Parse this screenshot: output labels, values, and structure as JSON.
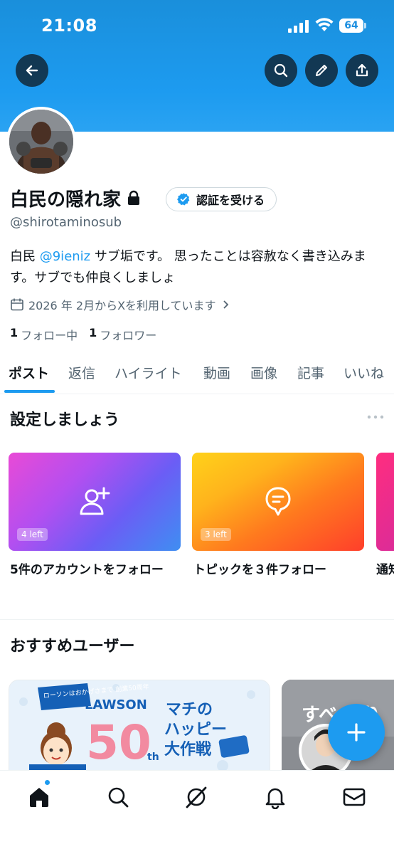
{
  "status_bar": {
    "time": "21:08",
    "battery": "64"
  },
  "profile": {
    "display_name": "白民の隠れ家",
    "verify_button": "認証を受ける",
    "handle": "@shirotaminosub",
    "bio_prefix": "白民 ",
    "bio_mention": "@9ieniz",
    "bio_suffix": " サブ垢です。 思ったことは容赦なく書き込みます。サブでも仲良くしましょ",
    "joined": "2026 年 2月からXを利用しています",
    "following_count": "1",
    "following_label": "フォロー中",
    "followers_count": "1",
    "followers_label": "フォロワー"
  },
  "tabs": [
    "ポスト",
    "返信",
    "ハイライト",
    "動画",
    "画像",
    "記事",
    "いいね"
  ],
  "setup": {
    "title": "設定しましょう",
    "cards": [
      {
        "badge": "4 left",
        "label": "5件のアカウントをフォロー",
        "icon": "add-user-icon"
      },
      {
        "badge": "3 left",
        "label": "トピックを３件フォロー",
        "icon": "topic-icon"
      },
      {
        "label": "通知"
      }
    ]
  },
  "recommended": {
    "title": "おすすめユーザー",
    "promo": {
      "ribbon_text": "ローソンはおかげさまで 創業50周年",
      "brand": "LAWSON",
      "number": "50",
      "suffix": "th",
      "tagline1": "マチの",
      "tagline2": "ハッピー",
      "tagline3": "大作戦"
    },
    "second_card_text": "すべ  かり"
  },
  "colors": {
    "accent": "#1d9bf0",
    "text": "#0f1419",
    "secondary": "#536471"
  },
  "bottom_nav": [
    "home-icon",
    "search-icon",
    "grok-icon",
    "bell-icon",
    "mail-icon"
  ]
}
